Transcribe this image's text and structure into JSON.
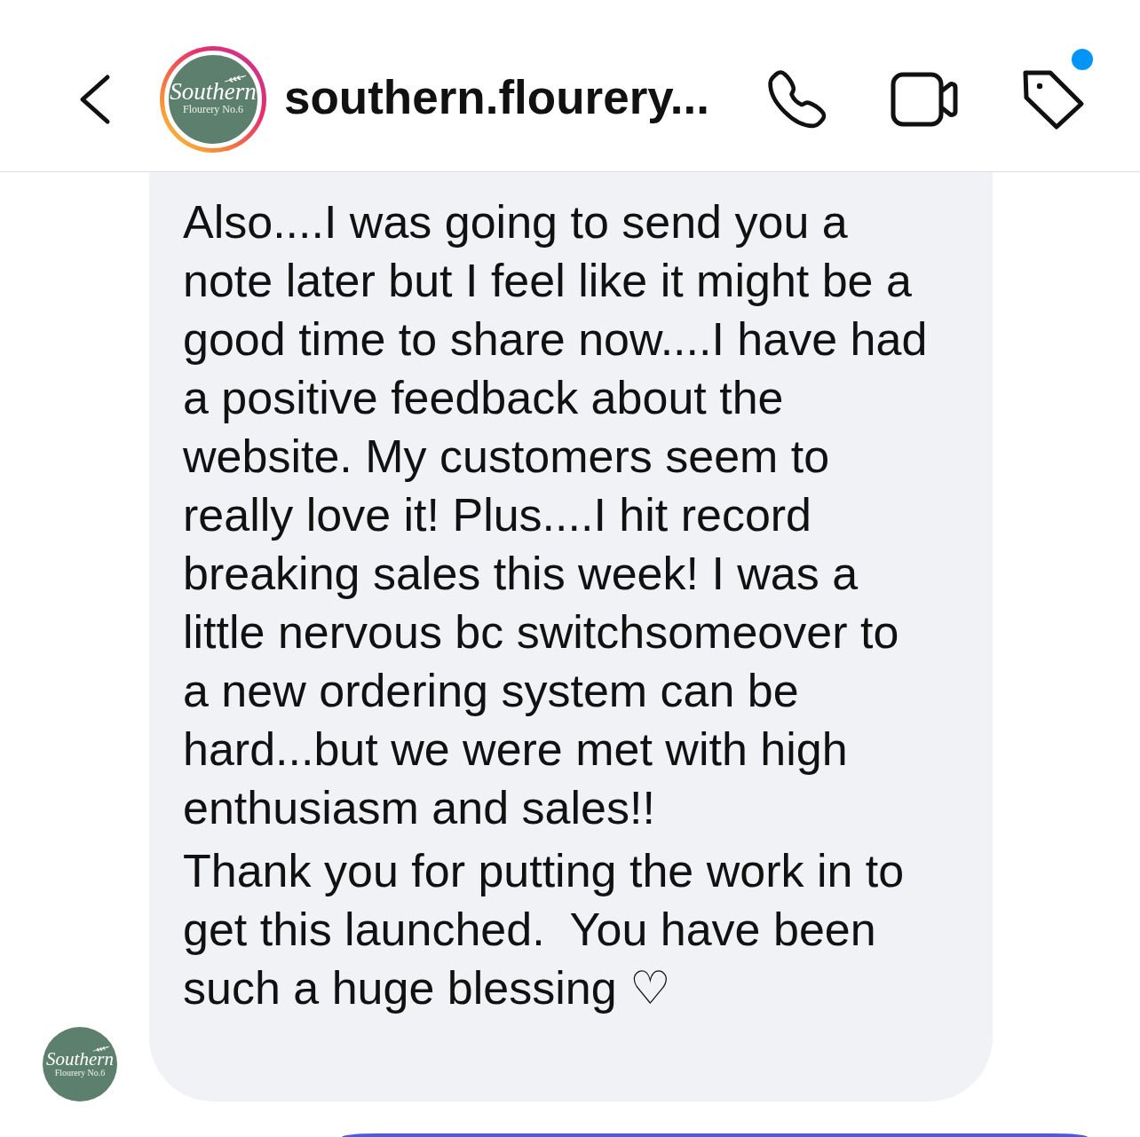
{
  "header": {
    "avatar": {
      "logo_title": "Southern",
      "logo_subtitle": "Flourery No.6",
      "story_ring": true
    },
    "title": "southern.flourery...",
    "notification_dot": true
  },
  "messages": [
    {
      "kind": "received",
      "avatar": {
        "logo_title": "Southern",
        "logo_subtitle": "Flourery No.6"
      },
      "paragraphs": [
        "Also....I was going to send you a\nnote later but I feel like it might be a\ngood time to share now....I have had\na positive feedback about the\nwebsite. My customers seem to\nreally love it! Plus....I hit record\nbreaking sales this week! I was a\nlittle nervous bc switchsomeover to\na new ordering system can be\nhard...but we were met with high\nenthusiasm and sales!!",
        "Thank you for putting the work in to\nget this launched.  You have been\nsuch a huge blessing ♡"
      ]
    },
    {
      "kind": "sent"
    }
  ]
}
